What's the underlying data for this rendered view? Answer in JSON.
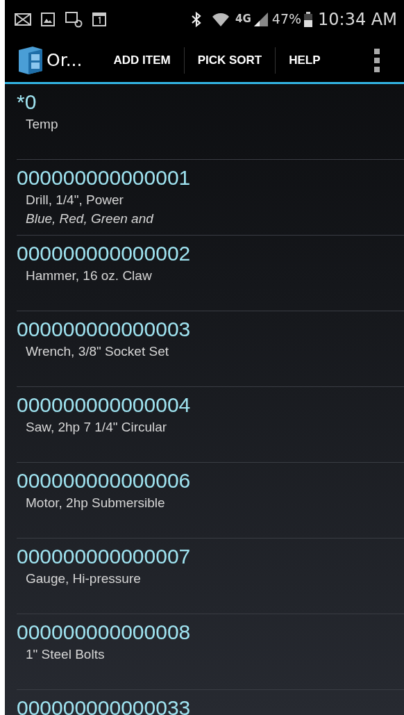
{
  "status_bar": {
    "network": "4G",
    "battery": "47%",
    "time": "10:34 AM"
  },
  "action_bar": {
    "title": "Or...",
    "actions": [
      "ADD ITEM",
      "PICK SORT",
      "HELP"
    ]
  },
  "items": [
    {
      "id": "*0",
      "description": "Temp"
    },
    {
      "id": "000000000000001",
      "description": "Drill, 1/4\", Power",
      "note": "Blue, Red, Green and"
    },
    {
      "id": "000000000000002",
      "description": "Hammer, 16 oz. Claw"
    },
    {
      "id": "000000000000003",
      "description": "Wrench, 3/8\" Socket Set"
    },
    {
      "id": "000000000000004",
      "description": "Saw, 2hp 7 1/4\" Circular"
    },
    {
      "id": "000000000000006",
      "description": "Motor, 2hp Submersible"
    },
    {
      "id": "000000000000007",
      "description": "Gauge, Hi-pressure"
    },
    {
      "id": "000000000000008",
      "description": "1\" Steel Bolts"
    },
    {
      "id": "000000000000033"
    }
  ]
}
